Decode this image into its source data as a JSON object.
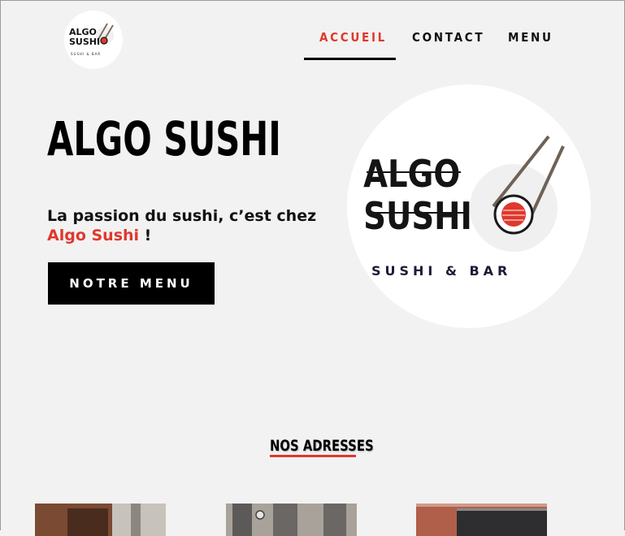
{
  "header": {
    "logo": {
      "line1": "ALGO",
      "line2": "SUSHI",
      "sub": "SUSHI & BAR"
    },
    "nav": [
      {
        "label": "ACCUEIL",
        "active": true
      },
      {
        "label": "CONTACT",
        "active": false
      },
      {
        "label": "MENU",
        "active": false
      }
    ]
  },
  "hero": {
    "title": "ALGO SUSHI",
    "tagline_prefix": "La passion du sushi, c’est chez",
    "tagline_brand": "Algo Sushi",
    "tagline_suffix": " !",
    "cta_label": "NOTRE MENU",
    "logo": {
      "line1": "ALGO",
      "line2": "SUSHI",
      "sub": "SUSHI & BAR"
    }
  },
  "addresses": {
    "title": "NOS ADRESSES",
    "photos": [
      "restaurant-storefront-1",
      "restaurant-storefront-2",
      "restaurant-storefront-3"
    ]
  },
  "colors": {
    "accent": "#e0382c",
    "background": "#f2f2f2",
    "dark": "#000000"
  }
}
